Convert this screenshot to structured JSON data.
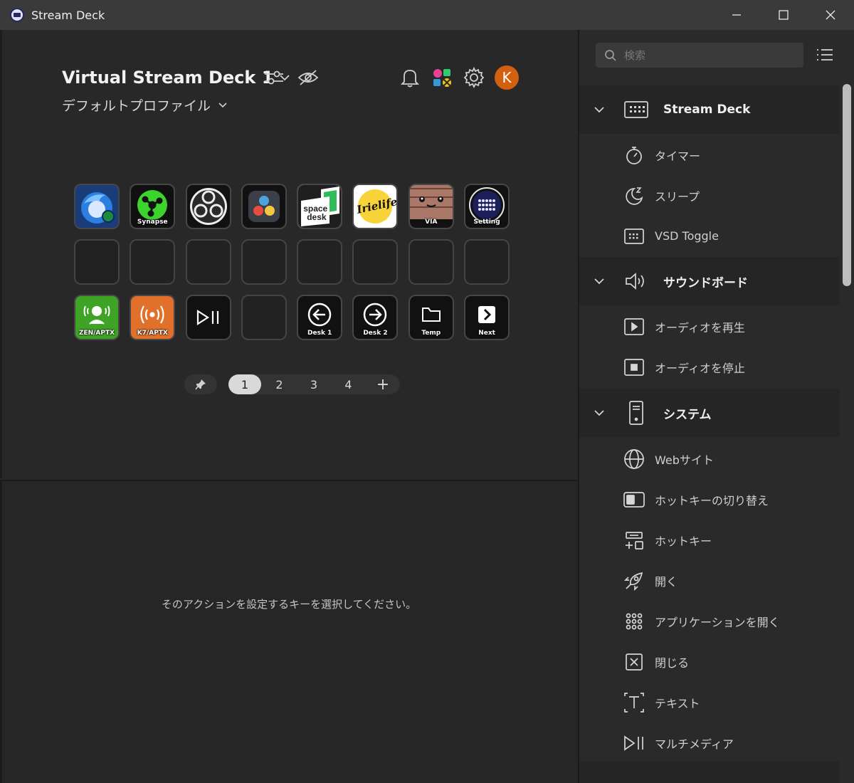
{
  "window": {
    "title": "Stream Deck"
  },
  "header": {
    "device_name": "Virtual Stream Deck 1",
    "profile_name": "デフォルトプロファイル",
    "avatar_letter": "K"
  },
  "keys": [
    {
      "label": ""
    },
    {
      "label": "Synapse"
    },
    {
      "label": ""
    },
    {
      "label": ""
    },
    {
      "label": ""
    },
    {
      "label": ""
    },
    {
      "label": "VIA"
    },
    {
      "label": "Setting"
    },
    {
      "label": ""
    },
    {
      "label": ""
    },
    {
      "label": ""
    },
    {
      "label": ""
    },
    {
      "label": ""
    },
    {
      "label": ""
    },
    {
      "label": ""
    },
    {
      "label": ""
    },
    {
      "label": "ZEN/APTX"
    },
    {
      "label": "K7/APTX"
    },
    {
      "label": ""
    },
    {
      "label": ""
    },
    {
      "label": "Desk 1"
    },
    {
      "label": "Desk 2"
    },
    {
      "label": "Temp"
    },
    {
      "label": "Next"
    }
  ],
  "key_art": {
    "spacedesk_line1": "space",
    "spacedesk_line2": "desk",
    "irielife": "Irielife"
  },
  "pager": {
    "pages": [
      "1",
      "2",
      "3",
      "4"
    ],
    "active": "1",
    "add": "+"
  },
  "hint_text": "そのアクションを設定するキーを選択してください。",
  "side": {
    "search_placeholder": "検索",
    "categories": [
      {
        "label": "Stream Deck",
        "items": [
          {
            "label": "タイマー"
          },
          {
            "label": "スリープ"
          },
          {
            "label": "VSD Toggle"
          }
        ]
      },
      {
        "label": "サウンドボード",
        "items": [
          {
            "label": "オーディオを再生"
          },
          {
            "label": "オーディオを停止"
          }
        ]
      },
      {
        "label": "システム",
        "items": [
          {
            "label": "Webサイト"
          },
          {
            "label": "ホットキーの切り替え"
          },
          {
            "label": "ホットキー"
          },
          {
            "label": "開く"
          },
          {
            "label": "アプリケーションを開く"
          },
          {
            "label": "閉じる"
          },
          {
            "label": "テキスト"
          },
          {
            "label": "マルチメディア"
          }
        ]
      }
    ]
  },
  "colors": {
    "accent_orange": "#d35f10",
    "panel": "#2a2a2a",
    "main": "#282828"
  }
}
